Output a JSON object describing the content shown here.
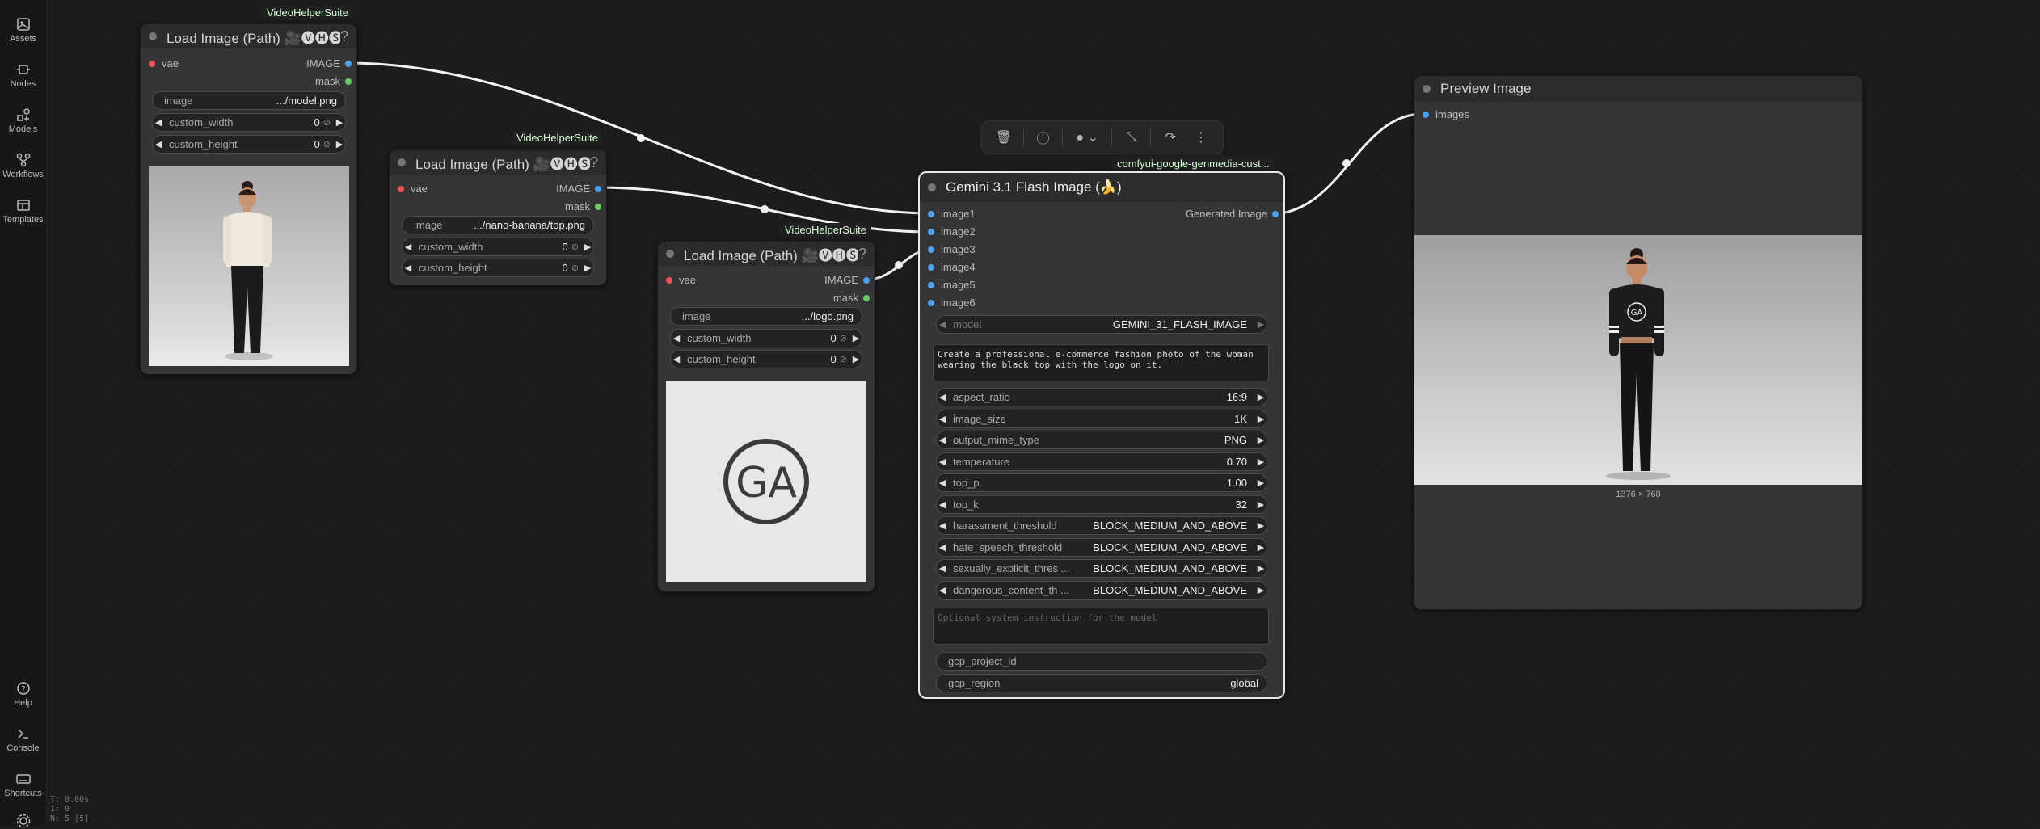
{
  "sidebar": {
    "items": [
      {
        "label": "Assets",
        "icon": "image-icon"
      },
      {
        "label": "Nodes",
        "icon": "nodes-icon"
      },
      {
        "label": "Models",
        "icon": "models-icon"
      },
      {
        "label": "Workflows",
        "icon": "workflow-icon"
      },
      {
        "label": "Templates",
        "icon": "templates-icon"
      }
    ],
    "bottom": [
      {
        "label": "Help",
        "icon": "help-icon"
      },
      {
        "label": "Console",
        "icon": "console-icon"
      },
      {
        "label": "Shortcuts",
        "icon": "keyboard-icon"
      }
    ],
    "stats": [
      "T: 0.00s",
      "I: 0",
      "N: 5 [5]"
    ]
  },
  "node_load1": {
    "badge": "VideoHelperSuite",
    "title": "Load Image (Path) 🎥🅥🅗🅢",
    "help": "?",
    "input_vae": "vae",
    "output_image": "IMAGE",
    "output_mask": "mask",
    "image_label": "image",
    "image_value": ".../model.png",
    "width_label": "custom_width",
    "width_value": "0",
    "height_label": "custom_height",
    "height_value": "0"
  },
  "node_load2": {
    "badge": "VideoHelperSuite",
    "title": "Load Image (Path) 🎥🅥🅗🅢",
    "help": "?",
    "input_vae": "vae",
    "output_image": "IMAGE",
    "output_mask": "mask",
    "image_label": "image",
    "image_value": ".../nano-banana/top.png",
    "width_label": "custom_width",
    "width_value": "0",
    "height_label": "custom_height",
    "height_value": "0"
  },
  "node_load3": {
    "badge": "VideoHelperSuite",
    "title": "Load Image (Path) 🎥🅥🅗🅢",
    "help": "?",
    "input_vae": "vae",
    "output_image": "IMAGE",
    "output_mask": "mask",
    "image_label": "image",
    "image_value": ".../logo.png",
    "width_label": "custom_width",
    "width_value": "0",
    "height_label": "custom_height",
    "height_value": "0",
    "logo_text": "GA"
  },
  "node_gemini": {
    "badge": "comfyui-google-genmedia-cust...",
    "title": "Gemini 3.1 Flash Image (🍌)",
    "inputs": [
      "image1",
      "image2",
      "image3",
      "image4",
      "image5",
      "image6"
    ],
    "output": "Generated Image",
    "model_label": "model",
    "model_value": "GEMINI_31_FLASH_IMAGE",
    "prompt": "Create a professional e-commerce fashion photo of the woman wearing the black top with the logo on it.",
    "params": [
      {
        "name": "aspect_ratio",
        "value": "16:9"
      },
      {
        "name": "image_size",
        "value": "1K"
      },
      {
        "name": "output_mime_type",
        "value": "PNG"
      },
      {
        "name": "temperature",
        "value": "0.70"
      },
      {
        "name": "top_p",
        "value": "1.00"
      },
      {
        "name": "top_k",
        "value": "32"
      },
      {
        "name": "harassment_threshold",
        "value": "BLOCK_MEDIUM_AND_ABOVE"
      },
      {
        "name": "hate_speech_threshold",
        "value": "BLOCK_MEDIUM_AND_ABOVE"
      },
      {
        "name": "sexually_explicit_thres ...",
        "value": "BLOCK_MEDIUM_AND_ABOVE"
      },
      {
        "name": "dangerous_content_th ...",
        "value": "BLOCK_MEDIUM_AND_ABOVE"
      }
    ],
    "system_placeholder": "Optional system instruction for the model",
    "gcp_project_label": "gcp_project_id",
    "gcp_project_value": "",
    "gcp_region_label": "gcp_region",
    "gcp_region_value": "global"
  },
  "node_preview": {
    "title": "Preview Image",
    "input": "images",
    "dims": "1376 × 768",
    "shirt_logo": "GA"
  },
  "toolbar": {
    "buttons": [
      "delete-icon",
      "info-icon",
      "color-icon",
      "collapse-icon",
      "bypass-icon",
      "more-icon"
    ]
  }
}
